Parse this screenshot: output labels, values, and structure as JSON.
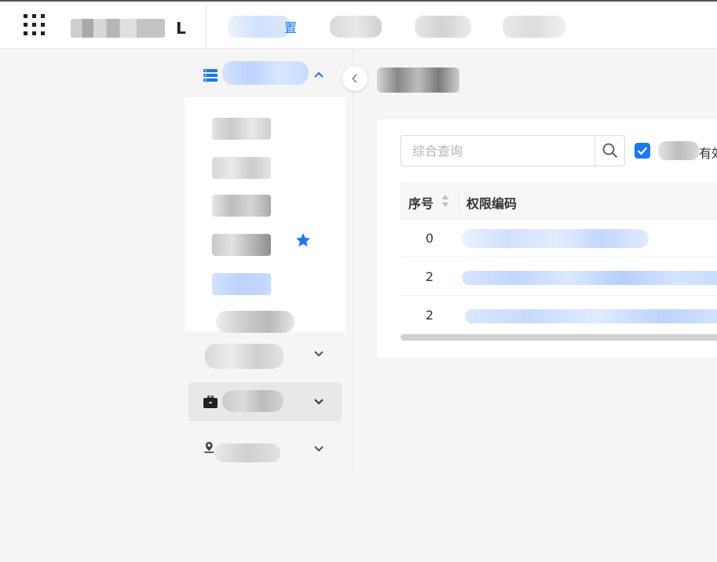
{
  "header": {
    "logo_text": "L",
    "nav": [
      {
        "label": "置"
      },
      {
        "label": ""
      },
      {
        "label": ""
      },
      {
        "label": ""
      }
    ]
  },
  "sidebar": {
    "groups": [
      {
        "icon": "server-icon",
        "expanded": true
      },
      {
        "icon": "",
        "expanded": false
      },
      {
        "icon": "briefcase-icon",
        "expanded": false
      },
      {
        "icon": "map-pin-user-icon",
        "expanded": false
      }
    ],
    "submenu_starred_index": 3
  },
  "main": {
    "search": {
      "placeholder": "综合查询"
    },
    "checkbox": {
      "checked": true,
      "label_suffix": "有效"
    },
    "table": {
      "columns": [
        "序号",
        "权限编码"
      ],
      "rows": [
        {
          "seq": "0"
        },
        {
          "seq": "2"
        },
        {
          "seq": "2"
        }
      ]
    }
  },
  "colors": {
    "accent": "#1677ff",
    "background": "#f5f5f5",
    "card": "#ffffff"
  }
}
